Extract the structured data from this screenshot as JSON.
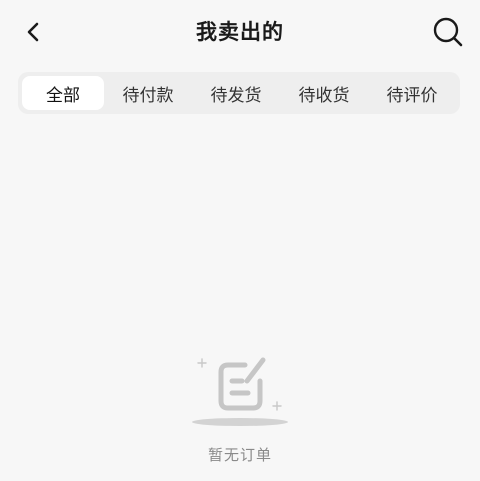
{
  "header": {
    "title": "我卖出的",
    "back_icon": "chevron-left-icon",
    "search_icon": "search-icon"
  },
  "tabs": [
    {
      "label": "全部",
      "active": true
    },
    {
      "label": "待付款",
      "active": false
    },
    {
      "label": "待发货",
      "active": false
    },
    {
      "label": "待收货",
      "active": false
    },
    {
      "label": "待评价",
      "active": false
    }
  ],
  "empty_state": {
    "icon": "empty-order-icon",
    "text": "暂无订单"
  }
}
